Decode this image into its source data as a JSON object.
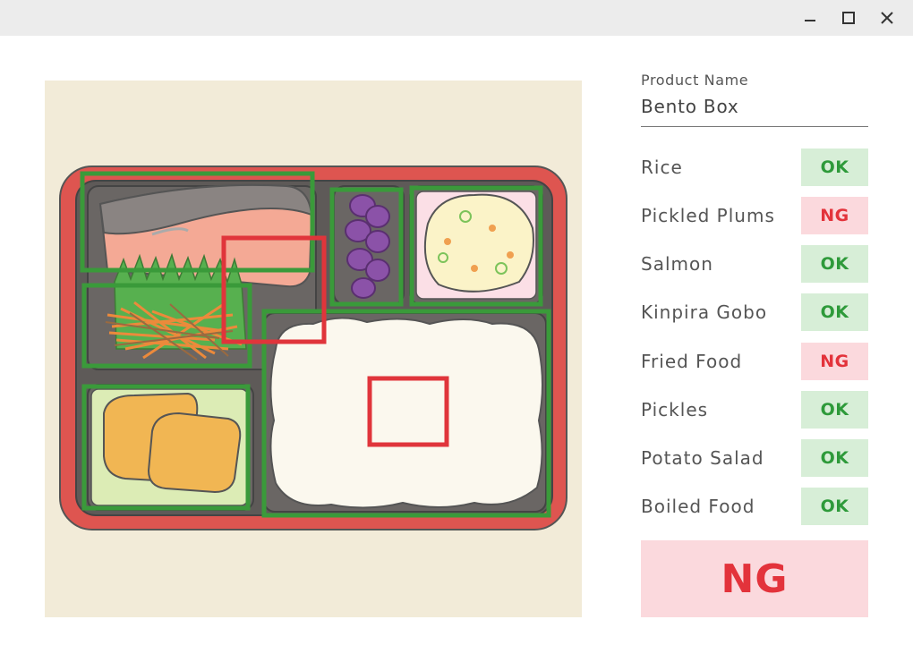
{
  "window": {
    "minimize_icon": "minimize-icon",
    "maximize_icon": "maximize-icon",
    "close_icon": "close-icon"
  },
  "colors": {
    "ok_bg": "#d7eed7",
    "ok_text": "#2e9a3a",
    "ng_bg": "#fbd9dd",
    "ng_text": "#e3333b",
    "pass_box": "#3a9a3a",
    "fail_box": "#e0353b"
  },
  "product": {
    "label": "Product Name",
    "value": "Bento Box"
  },
  "inspection_items": [
    {
      "label": "Rice",
      "result": "OK"
    },
    {
      "label": "Pickled Plums",
      "result": "NG"
    },
    {
      "label": "Salmon",
      "result": "OK"
    },
    {
      "label": "Kinpira Gobo",
      "result": "OK"
    },
    {
      "label": "Fried Food",
      "result": "NG"
    },
    {
      "label": "Pickles",
      "result": "OK"
    },
    {
      "label": "Potato Salad",
      "result": "OK"
    },
    {
      "label": "Boiled Food",
      "result": "OK"
    }
  ],
  "overall_result": "NG"
}
